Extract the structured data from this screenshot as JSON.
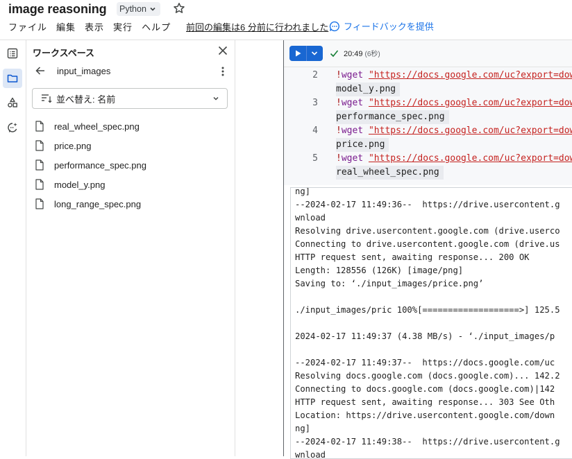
{
  "header": {
    "title": "image reasoning",
    "language": "Python",
    "menu": [
      "ファイル",
      "編集",
      "表示",
      "実行",
      "ヘルプ"
    ],
    "last_edit": "前回の編集は6 分前に行われました",
    "feedback": "フィードバックを提供"
  },
  "panel": {
    "title": "ワークスペース",
    "folder": "input_images",
    "sort_label": "並べ替え: 名前",
    "files": [
      "real_wheel_spec.png",
      "price.png",
      "performance_spec.png",
      "model_y.png",
      "long_range_spec.png"
    ]
  },
  "cell": {
    "run_time": "20:49",
    "run_duration": "(6秒)",
    "code": [
      {
        "line": "2",
        "bang": "!",
        "cmd": "wget",
        "url": "\"https://docs.google.com/uc?export=dow",
        "cont": "model_y.png"
      },
      {
        "line": "3",
        "bang": "!",
        "cmd": "wget",
        "url": "\"https://docs.google.com/uc?export=dow",
        "cont": "performance_spec.png"
      },
      {
        "line": "4",
        "bang": "!",
        "cmd": "wget",
        "url": "\"https://docs.google.com/uc?export=dow",
        "cont": "price.png"
      },
      {
        "line": "5",
        "bang": "!",
        "cmd": "wget",
        "url": "\"https://docs.google.com/uc?export=dow",
        "cont": "real_wheel_spec.png"
      }
    ],
    "output": [
      "ng]",
      "--2024-02-17 11:49:36--  https://drive.usercontent.g",
      "wnload",
      "Resolving drive.usercontent.google.com (drive.userco",
      "Connecting to drive.usercontent.google.com (drive.us",
      "HTTP request sent, awaiting response... 200 OK",
      "Length: 128556 (126K) [image/png]",
      "Saving to: ‘./input_images/price.png’",
      "",
      "./input_images/pric 100%[===================>] 125.5",
      "",
      "2024-02-17 11:49:37 (4.38 MB/s) - ‘./input_images/p",
      "",
      "--2024-02-17 11:49:37--  https://docs.google.com/uc",
      "Resolving docs.google.com (docs.google.com)... 142.2",
      "Connecting to docs.google.com (docs.google.com)|142",
      "HTTP request sent, awaiting response... 303 See Oth",
      "Location: https://drive.usercontent.google.com/down",
      "ng]",
      "--2024-02-17 11:49:38--  https://drive.usercontent.g",
      "wnload"
    ]
  },
  "colors": {
    "accent": "#1967d2",
    "link": "#1a73e8",
    "string": "#c5221f",
    "bang": "#a50e0e",
    "command": "#7a1b8e",
    "active_rail": "#dde7f6",
    "success": "#188038"
  },
  "icons": {
    "rail": [
      "toc-icon",
      "folder-icon",
      "shapes-icon",
      "ai-assist-icon"
    ],
    "files": "file-icon"
  }
}
